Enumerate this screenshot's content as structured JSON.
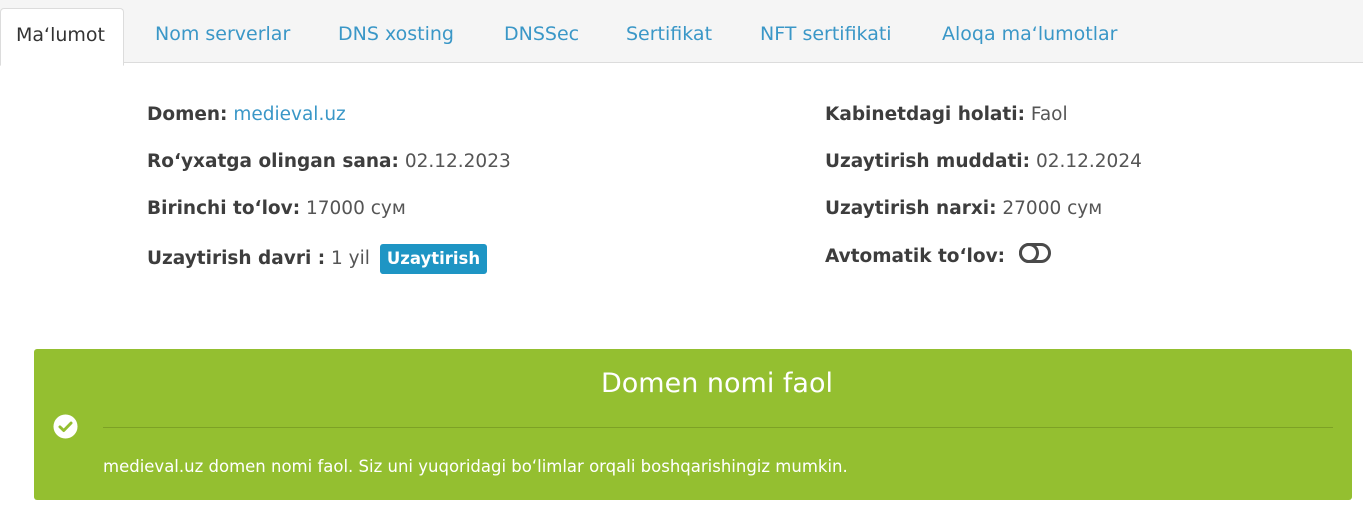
{
  "tabs": [
    {
      "label": "Maʻlumot",
      "active": true
    },
    {
      "label": "Nom serverlar",
      "active": false
    },
    {
      "label": "DNS xosting",
      "active": false
    },
    {
      "label": "DNSSec",
      "active": false
    },
    {
      "label": "Sertifikat",
      "active": false
    },
    {
      "label": "NFT sertifikati",
      "active": false
    },
    {
      "label": "Aloqa maʻlumotlar",
      "active": false
    }
  ],
  "info": {
    "domain_label": "Domen:",
    "domain_value": "medieval.uz",
    "registered_label": "Roʻyxatga olingan sana:",
    "registered_value": "02.12.2023",
    "first_payment_label": "Birinchi toʻlov:",
    "first_payment_value": "17000 сум",
    "renew_period_label": "Uzaytirish davri :",
    "renew_period_value": "1 yil",
    "renew_button": "Uzaytirish",
    "status_label": "Kabinetdagi holati:",
    "status_value": "Faol",
    "renew_term_label": "Uzaytirish muddati:",
    "renew_term_value": "02.12.2024",
    "renew_price_label": "Uzaytirish narxi:",
    "renew_price_value": "27000 сум",
    "auto_payment_label": "Avtomatik toʻlov:",
    "auto_payment_enabled": false
  },
  "alert": {
    "title": "Domen nomi faol",
    "message": "medieval.uz domen nomi faol. Siz uni yuqoridagi boʻlimlar orqali boshqarishingiz mumkin.",
    "icon": "check-circle-icon",
    "color": "#94bf30"
  },
  "colors": {
    "link": "#3a97c7",
    "badge": "#1e95c4"
  }
}
